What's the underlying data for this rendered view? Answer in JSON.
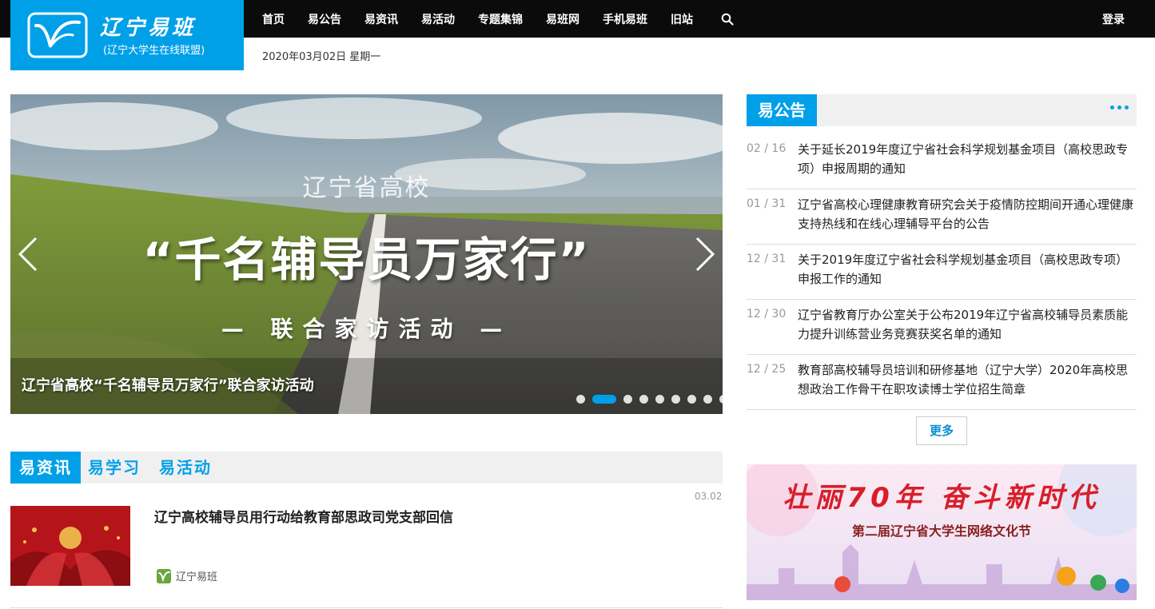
{
  "logo": {
    "title": "辽宁易班",
    "subtitle": "(辽宁大学生在线联盟)"
  },
  "nav": {
    "items": [
      "首页",
      "易公告",
      "易资讯",
      "易活动",
      "专题集锦",
      "易班网",
      "手机易班",
      "旧站"
    ],
    "search_icon": "search-icon",
    "login_label": "登录"
  },
  "date_text": "2020年03月02日 星期一",
  "slider": {
    "subtitle": "辽宁省高校",
    "headline": "“千名辅导员万家行”",
    "tagline": "— 联合家访活动 —",
    "caption": "辽宁省高校“千名辅导员万家行”联合家访活动",
    "dot_count": 9,
    "active_dot": 1
  },
  "announcements": {
    "heading": "易公告",
    "more_label": "更多",
    "items": [
      {
        "date": "02 / 16",
        "title": "关于延长2019年度辽宁省社会科学规划基金项目（高校思政专项）申报周期的通知"
      },
      {
        "date": "01 / 31",
        "title": "辽宁省高校心理健康教育研究会关于疫情防控期间开通心理健康支持热线和在线心理辅导平台的公告"
      },
      {
        "date": "12 / 31",
        "title": "关于2019年度辽宁省社会科学规划基金项目（高校思政专项）申报工作的通知"
      },
      {
        "date": "12 / 30",
        "title": "辽宁省教育厅办公室关于公布2019年辽宁省高校辅导员素质能力提升训练营业务竞赛获奖名单的通知"
      },
      {
        "date": "12 / 25",
        "title": "教育部高校辅导员培训和研修基地（辽宁大学）2020年高校思想政治工作骨干在职攻读博士学位招生简章"
      }
    ]
  },
  "banner": {
    "title": "壮丽70年 奋斗新时代",
    "subtitle": "第二届辽宁省大学生网络文化节"
  },
  "news": {
    "tabs": [
      "易资讯",
      "易学习",
      "易活动"
    ],
    "items": [
      {
        "title": "辽宁高校辅导员用行动给教育部思政司党支部回信",
        "date": "03.02",
        "source": "辽宁易班"
      }
    ]
  },
  "colors": {
    "brand": "#00a0e9",
    "topbar": "#0b0b0b"
  }
}
